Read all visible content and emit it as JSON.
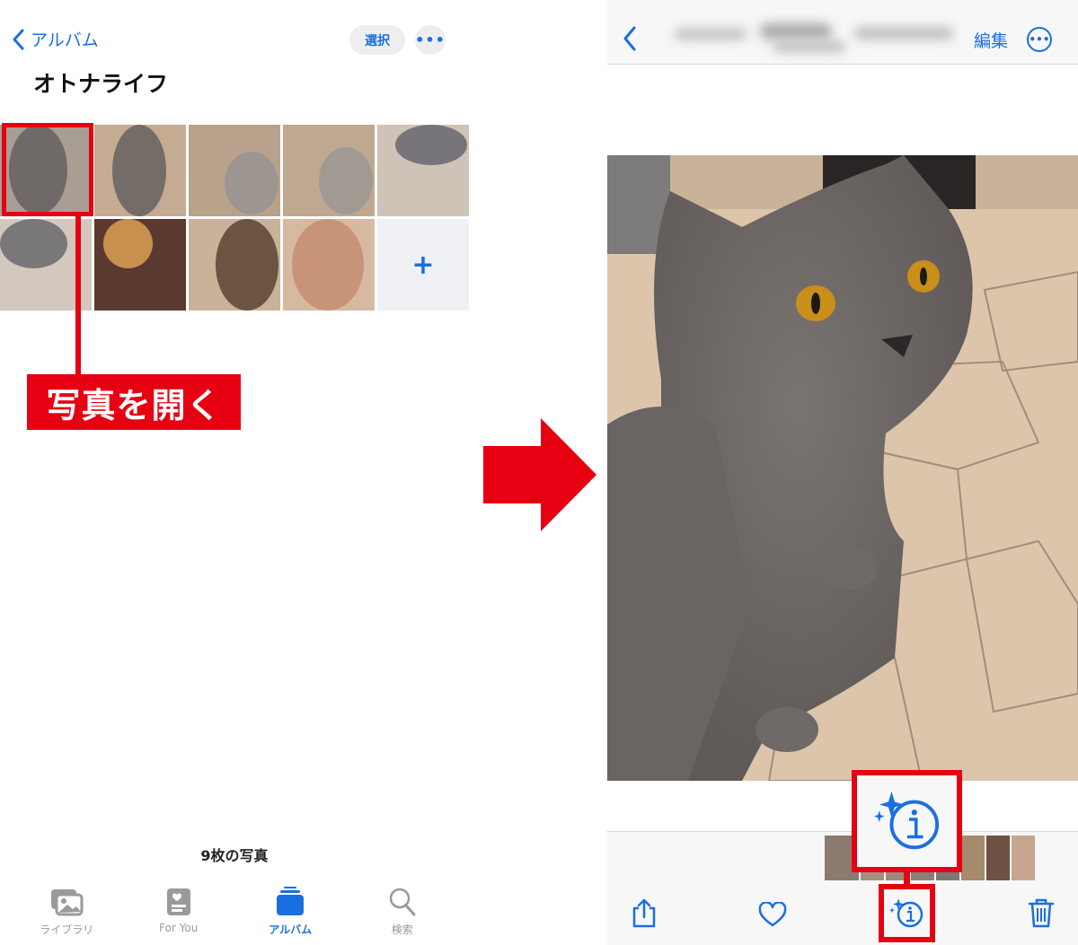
{
  "left_screen": {
    "back_label": "アルバム",
    "select_label": "選択",
    "more_label": "•••",
    "album_title": "オトナライフ",
    "photo_grid": {
      "columns": 5,
      "items": [
        {
          "name": "gray-cat-sitting",
          "tone": "#a99e94",
          "cat": "#6f6a68"
        },
        {
          "name": "gray-cat-back",
          "tone": "#c4ab92",
          "cat": "#746c67"
        },
        {
          "name": "cat-with-toy",
          "tone": "#b8a28b",
          "cat": "#9d958f"
        },
        {
          "name": "cat-with-toy-2",
          "tone": "#c0a78f",
          "cat": "#a19a93"
        },
        {
          "name": "gray-cat-lying",
          "tone": "#cfc3b7",
          "cat": "#77757a"
        },
        {
          "name": "gray-cat-sleeping",
          "tone": "#d3c8be",
          "cat": "#7a7779"
        },
        {
          "name": "orange-cat",
          "tone": "#5a3a2e",
          "cat": "#c8904f"
        },
        {
          "name": "tabby-cat",
          "tone": "#c9b19a",
          "cat": "#6b5442"
        },
        {
          "name": "orange-cat-closeup",
          "tone": "#d7b8a1",
          "cat": "#c89477"
        }
      ],
      "add_label": "+"
    },
    "callout_label": "写真を開く",
    "photo_count": "9枚の写真",
    "tabs": [
      {
        "label": "ライブラリ",
        "icon": "photo-library-icon",
        "active": false
      },
      {
        "label": "For You",
        "icon": "for-you-icon",
        "active": false
      },
      {
        "label": "アルバム",
        "icon": "albums-icon",
        "active": true
      },
      {
        "label": "検索",
        "icon": "search-icon",
        "active": false
      }
    ]
  },
  "right_screen": {
    "title": "(blurred)",
    "edit_label": "編集",
    "more_label": "•••",
    "photo": {
      "subject": "gray cat with yellow eyes on hexagon tile floor"
    },
    "toolbar": [
      {
        "icon": "share-icon"
      },
      {
        "icon": "heart-icon"
      },
      {
        "icon": "visual-lookup-info-icon"
      },
      {
        "icon": "trash-icon"
      }
    ],
    "thumbnail_tones": [
      "#8b7b6e",
      "#a58f7c",
      "#9e8877",
      "#8e7f74",
      "#7c7672",
      "#a58a6c",
      "#6d5142",
      "#c7a690"
    ]
  },
  "colors": {
    "accent": "#1a6fe0",
    "annotation_red": "#e60012"
  }
}
